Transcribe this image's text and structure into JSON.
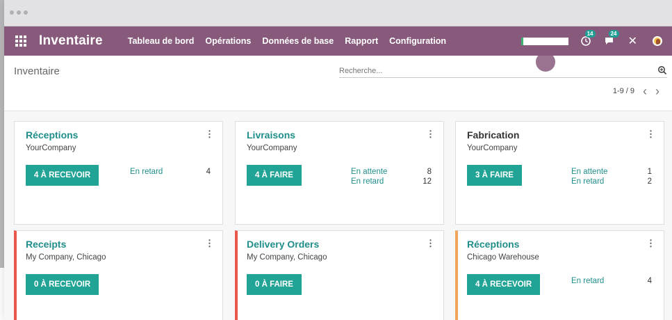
{
  "navbar": {
    "brand": "Inventaire",
    "menu": [
      "Tableau de bord",
      "Opérations",
      "Données de base",
      "Rapport",
      "Configuration"
    ],
    "badges": {
      "activities": "14",
      "messages": "24"
    },
    "close_symbol": "✕"
  },
  "control": {
    "breadcrumb": "Inventaire",
    "search_placeholder": "Recherche...",
    "pager": "1-9 / 9",
    "prev": "‹",
    "next": "›"
  },
  "colors": {
    "navbar": "#875a7b",
    "accent": "#21a396",
    "late_red": "#e8574a",
    "warn_orange": "#f0a35b"
  },
  "cards": [
    {
      "title": "Réceptions",
      "company": "YourCompany",
      "action": "4 À RECEVOIR",
      "stats": [
        {
          "label": "En retard",
          "value": "4"
        }
      ]
    },
    {
      "title": "Livraisons",
      "company": "YourCompany",
      "action": "4 À FAIRE",
      "stats": [
        {
          "label": "En attente",
          "value": "8"
        },
        {
          "label": "En retard",
          "value": "12"
        }
      ]
    },
    {
      "title": "Fabrication",
      "company": "YourCompany",
      "action": "3 À FAIRE",
      "stats": [
        {
          "label": "En attente",
          "value": "1"
        },
        {
          "label": "En retard",
          "value": "2"
        }
      ]
    },
    {
      "title": "Receipts",
      "company": "My Company, Chicago",
      "action": "0 À RECEVOIR",
      "stats": []
    },
    {
      "title": "Delivery Orders",
      "company": "My Company, Chicago",
      "action": "0 À FAIRE",
      "stats": []
    },
    {
      "title": "Réceptions",
      "company": "Chicago Warehouse",
      "action": "4 À RECEVOIR",
      "stats": [
        {
          "label": "En retard",
          "value": "4"
        }
      ]
    }
  ],
  "icons": {
    "apps": "apps-grid-icon",
    "activity": "clock-icon",
    "messages": "chat-icon",
    "search": "magnifier-icon",
    "kebab": "kebab-menu-icon"
  }
}
